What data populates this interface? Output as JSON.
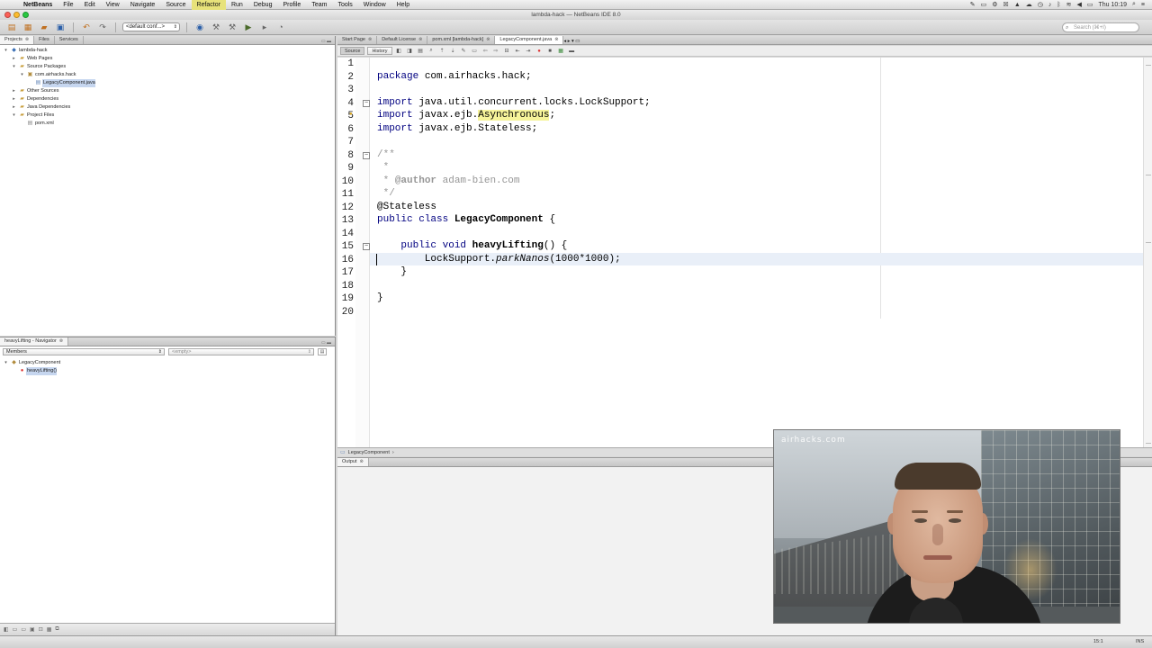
{
  "menubar": {
    "items": [
      "NetBeans",
      "File",
      "Edit",
      "View",
      "Navigate",
      "Source",
      "Refactor",
      "Run",
      "Debug",
      "Profile",
      "Team",
      "Tools",
      "Window",
      "Help"
    ],
    "clock": "Thu 10:19"
  },
  "window": {
    "title": "lambda-hack — NetBeans IDE 8.0"
  },
  "toolbar": {
    "config": "<default conf...>",
    "search_placeholder": "Search (⌘+I)"
  },
  "projects": {
    "tabs": [
      "Projects",
      "Files",
      "Services"
    ],
    "tree": [
      {
        "label": "lambda-hack",
        "depth": 0,
        "icon": "project-icon",
        "tog": "▾"
      },
      {
        "label": "Web Pages",
        "depth": 1,
        "icon": "folder-icon",
        "tog": "▸"
      },
      {
        "label": "Source Packages",
        "depth": 1,
        "icon": "folder-icon",
        "tog": "▾"
      },
      {
        "label": "com.airhacks.hack",
        "depth": 2,
        "icon": "package-icon",
        "tog": "▾"
      },
      {
        "label": "LegacyComponent.java",
        "depth": 3,
        "icon": "java-file-icon",
        "tog": "",
        "selected": true
      },
      {
        "label": "Other Sources",
        "depth": 1,
        "icon": "folder-icon",
        "tog": "▸"
      },
      {
        "label": "Dependencies",
        "depth": 1,
        "icon": "folder-icon",
        "tog": "▸"
      },
      {
        "label": "Java Dependencies",
        "depth": 1,
        "icon": "folder-icon",
        "tog": "▸"
      },
      {
        "label": "Project Files",
        "depth": 1,
        "icon": "folder-icon",
        "tog": "▾"
      },
      {
        "label": "pom.xml",
        "depth": 2,
        "icon": "xml-file-icon",
        "tog": ""
      }
    ]
  },
  "navigator": {
    "tab": "heavyLifting - Navigator",
    "members_combo": "Members",
    "empty_combo": "<empty>",
    "tree": [
      {
        "label": "LegacyComponent",
        "depth": 0,
        "tog": "▾"
      },
      {
        "label": "heavyLifting()",
        "depth": 1,
        "tog": "",
        "selected": true
      }
    ]
  },
  "editor": {
    "tabs": [
      "Start Page",
      "Default License",
      "pom.xml [lambda-hack]",
      "LegacyComponent.java"
    ],
    "active_tab": "LegacyComponent.java",
    "source_btn": "Source",
    "history_btn": "History",
    "line_numbers": [
      "1",
      "2",
      "3",
      "4",
      "5",
      "6",
      "7",
      "8",
      "9",
      "10",
      "11",
      "12",
      "13",
      "14",
      "15",
      "16",
      "17",
      "18",
      "19",
      "20"
    ],
    "code": {
      "l2_kw": "package",
      "l2_rest": " com.airhacks.hack;",
      "l4_kw": "import",
      "l4_rest": " java.util.concurrent.locks.LockSupport;",
      "l5_kw": "import",
      "l5_pre": " javax.ejb.",
      "l5_hl": "Asynchronous",
      "l5_post": ";",
      "l6_kw": "import",
      "l6_rest": " javax.ejb.Stateless;",
      "l8": "/**",
      "l9": " *",
      "l10_pre": " * ",
      "l10_tag": "@author",
      "l10_rest": " adam-bien.com",
      "l11": " */",
      "l12": "@Stateless",
      "l13_kw": "public class",
      "l13_name": " LegacyComponent",
      "l13_rest": " {",
      "l15_indent": "    ",
      "l15_kw": "public void",
      "l15_name": " heavyLifting",
      "l15_rest": "() {",
      "l16_pre": "        LockSupport.",
      "l16_method": "parkNanos",
      "l16_rest": "(1000*1000);",
      "l17": "    }",
      "l19": "}"
    },
    "breadcrumb": "LegacyComponent"
  },
  "output": {
    "tab": "Output"
  },
  "statusbar": {
    "position": "15:1",
    "mode": "INS"
  },
  "webcam": {
    "watermark": "airhacks.com"
  }
}
